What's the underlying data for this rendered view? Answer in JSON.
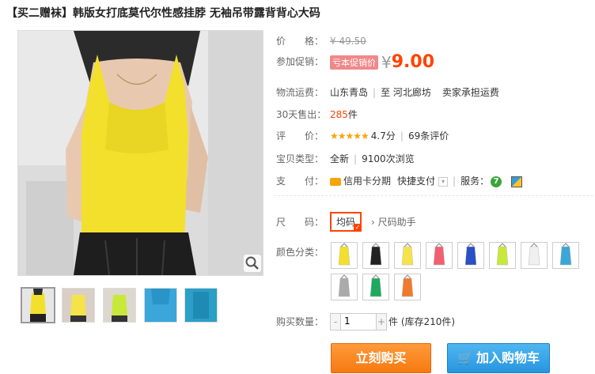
{
  "title": "【买二赠袜】韩版女打底莫代尔性感挂脖 无袖吊带露背背心大码",
  "price": {
    "label": "价　　格：",
    "original": "¥ 49.50"
  },
  "promo": {
    "label": "参加促销：",
    "tag": "亏本促销价",
    "currency": "¥",
    "value": "9.00"
  },
  "shipping": {
    "label": "物流运费：",
    "from": "山东青岛",
    "to": "至 河北廊坊",
    "fee": "卖家承担运费"
  },
  "sales": {
    "label": "30天售出：",
    "count": "285",
    "unit": "件"
  },
  "rating": {
    "label": "评　　价：",
    "stars": "★★★★★",
    "score": "4.7分",
    "reviews": "69条评价"
  },
  "item_type": {
    "label": "宝贝类型：",
    "condition": "全新",
    "views": "9100次浏览"
  },
  "payment": {
    "label": "支　　付：",
    "credit": "信用卡分期",
    "quick": "快捷支付",
    "service_label": "服务："
  },
  "size": {
    "label": "尺　　码：",
    "option": "均码",
    "helper": "尺码助手"
  },
  "colors": {
    "label": "颜色分类：",
    "swatches": [
      "#f2e02c",
      "#222222",
      "#f5e34a",
      "#f06070",
      "#2b4fc4",
      "#c8e83a",
      "#f0f0f0",
      "#3aa7d8",
      "#aaaaaa",
      "#1fa860",
      "#f07a2c"
    ]
  },
  "quantity": {
    "label": "购买数量：",
    "value": "1",
    "stock": "件 (库存210件)"
  },
  "buttons": {
    "buy": "立刻购买",
    "cart": "加入购物车"
  },
  "thumbs": [
    "#f2e02c",
    "#f5e34a",
    "#c8e83a",
    "#3aa7d8",
    "#2a9fc8"
  ]
}
